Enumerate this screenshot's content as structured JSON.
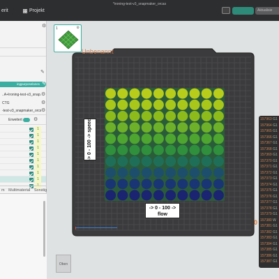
{
  "window": {
    "title": "*ironing-test-v3_snapmaker_orcas",
    "menu": [
      "erit",
      "Projekt"
    ],
    "buttons": {
      "primary": "",
      "secondary": "Aktualisie"
    }
  },
  "left_panel": {
    "filament_pill": "ingpurposelanes",
    "plate_label": "1",
    "file_line_1": "..A+Ironing-test-v3_snap...",
    "file_line_2": "CTG",
    "file_line_3": "-test-v3_snapmaker_orcs...",
    "expert_label": "Erweitert",
    "object_rows": [
      {
        "value": "1"
      },
      {
        "value": "1"
      },
      {
        "value": "1"
      },
      {
        "value": "1"
      },
      {
        "value": "1"
      },
      {
        "value": "1"
      },
      {
        "value": "1"
      },
      {
        "value": "1"
      },
      {
        "value": "1"
      },
      {
        "value": "1"
      }
    ],
    "tabs": [
      "m",
      "Multimaterial",
      "Sonstiges"
    ]
  },
  "plate": {
    "number": "1",
    "bed_name": "Unbenannt"
  },
  "annotations": {
    "speed_label": "-> 0 - 100 -> speed",
    "flow_line_1": "-> 0 - 100 ->",
    "flow_line_2": "flow"
  },
  "circle_grid": {
    "cols": 10,
    "rows": 10,
    "row_colors": [
      "#b8cc1b",
      "#a9c61b",
      "#8dbb1c",
      "#6fb02a",
      "#4ea530",
      "#2f8f3c",
      "#1f6f58",
      "#1d4f6d",
      "#1a3574",
      "#1a2470"
    ]
  },
  "console": {
    "lines": [
      {
        "n": "157963",
        "t": "G1"
      },
      {
        "n": "157964",
        "t": "G1"
      },
      {
        "n": "157965",
        "t": "G1"
      },
      {
        "n": "157366",
        "t": "G1"
      },
      {
        "n": "157367",
        "t": "G1"
      },
      {
        "n": "157368",
        "t": "G1"
      },
      {
        "n": "157369",
        "t": "G1"
      },
      {
        "n": "157370",
        "t": "G1"
      },
      {
        "n": "157371",
        "t": "G1"
      },
      {
        "n": "157372",
        "t": "G1"
      },
      {
        "n": "157373",
        "t": "G1"
      },
      {
        "n": "157374",
        "t": "G1"
      },
      {
        "n": "157375",
        "t": "G1"
      },
      {
        "n": "157376",
        "t": "G1"
      },
      {
        "n": "157377",
        "t": "G1"
      },
      {
        "n": "157378",
        "t": "G1"
      },
      {
        "n": "157379",
        "t": "G1"
      },
      {
        "n": "157380",
        "t": "W"
      },
      {
        "n": "157381",
        "t": "G1"
      },
      {
        "n": "157382",
        "t": "G1"
      },
      {
        "n": "157383",
        "t": "G1"
      },
      {
        "n": "157384",
        "t": "G1"
      },
      {
        "n": "157385",
        "t": "G1"
      },
      {
        "n": "157386",
        "t": "G1"
      },
      {
        "n": "157387",
        "t": "G1"
      }
    ],
    "side_value": "0"
  },
  "view_cube": {
    "label": "Oben"
  },
  "colors": {
    "accent": "#3aaea0",
    "bed": "#3a3a3c",
    "bed_name": "#c8794a"
  }
}
